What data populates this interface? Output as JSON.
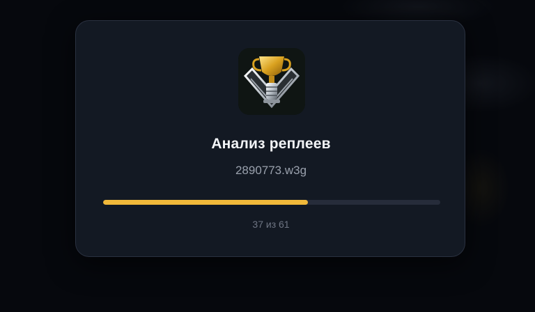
{
  "dialog": {
    "icon": "trophy-cup-icon",
    "title": "Анализ реплеев",
    "filename": "2890773.w3g",
    "progress": {
      "current": 37,
      "total": 61,
      "fraction": 0.6066,
      "label": "37 из 61"
    }
  },
  "colors": {
    "accent": "#f1b93a",
    "dialog_bg": "#131923",
    "track": "#262c3a",
    "title_text": "#f2f4f7",
    "muted_text": "#9aa1ad"
  }
}
